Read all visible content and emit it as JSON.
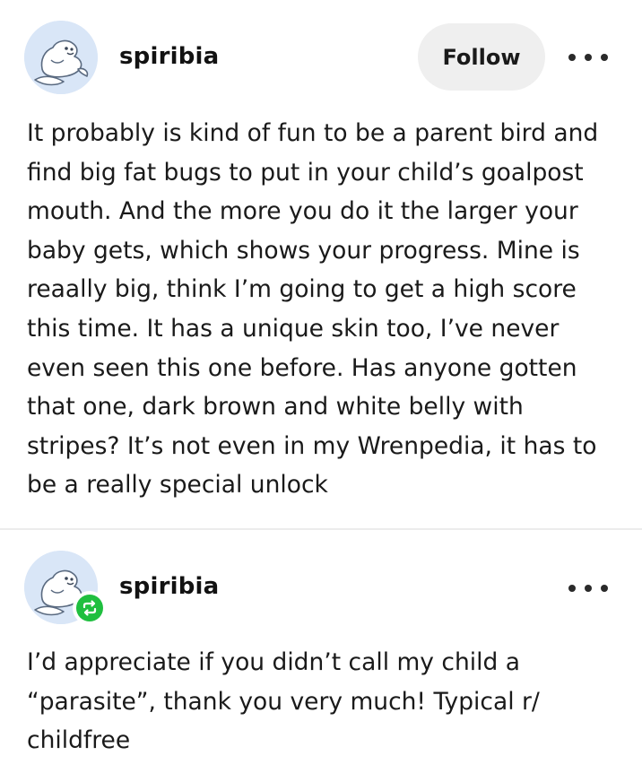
{
  "posts": [
    {
      "username": "spiribia",
      "follow_label": "Follow",
      "avatar_icon": "seal-avatar-icon",
      "more_icon": "more-dots-icon",
      "body": "It probably is kind of fun to be a parent bird and\nfind big fat bugs to put in your child’s goalpost\nmouth. And the more you do it the larger your\nbaby gets, which shows your progress. Mine is\nreaally big, think I’m going to get a high score\nthis time. It has a unique skin too, I’ve never\neven seen this one before. Has anyone gotten\nthat one, dark brown and white belly with\nstripes? It’s not even in my Wrenpedia, it has to\nbe a really special unlock"
    },
    {
      "username": "spiribia",
      "avatar_icon": "seal-avatar-icon",
      "badge_icon": "reblog-icon",
      "more_icon": "more-dots-icon",
      "body": "I’d appreciate if you didn’t call my child a\n“parasite”, thank you very much! Typical r/\nchildfree"
    }
  ],
  "colors": {
    "avatar_bg": "#d9e6f7",
    "follow_bg": "#efefef",
    "reblog_green": "#1fbf3f",
    "divider": "#ececec"
  }
}
